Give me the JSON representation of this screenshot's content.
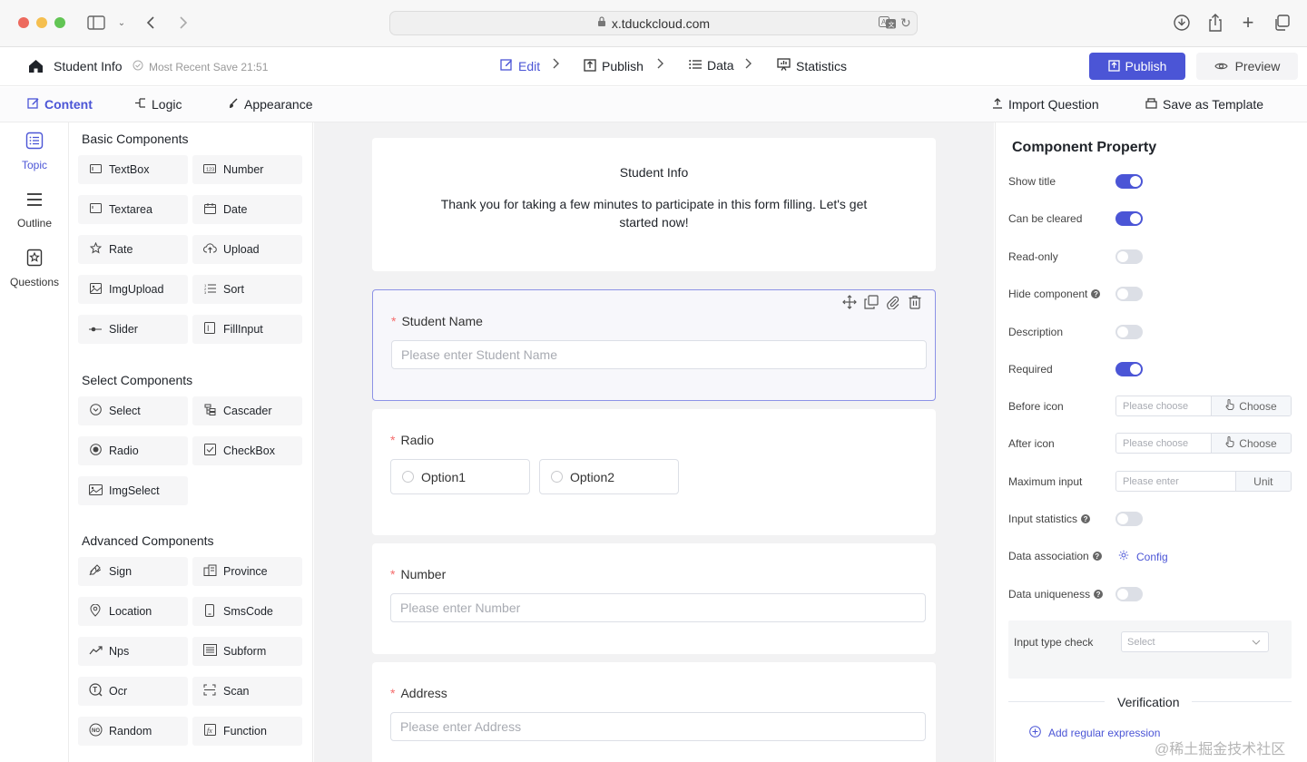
{
  "browser": {
    "url": "x.tduckcloud.com",
    "traffic": [
      "#ed6a5e",
      "#f5bf4f",
      "#62c554"
    ]
  },
  "header": {
    "title": "Student Info",
    "save_status": "Most Recent Save 21:51",
    "steps": [
      "Edit",
      "Publish",
      "Data",
      "Statistics"
    ],
    "active_step": "Edit",
    "publish_label": "Publish",
    "preview_label": "Preview"
  },
  "toolbar": {
    "tabs": [
      "Content",
      "Logic",
      "Appearance"
    ],
    "active_tab": "Content",
    "import_label": "Import Question",
    "template_label": "Save as Template"
  },
  "rail": {
    "items": [
      "Topic",
      "Outline",
      "Questions"
    ],
    "active": "Topic"
  },
  "components": {
    "basic_title": "Basic Components",
    "basic": [
      "TextBox",
      "Number",
      "Textarea",
      "Date",
      "Rate",
      "Upload",
      "ImgUpload",
      "Sort",
      "Slider",
      "FillInput"
    ],
    "select_title": "Select Components",
    "select": [
      "Select",
      "Cascader",
      "Radio",
      "CheckBox",
      "ImgSelect"
    ],
    "advanced_title": "Advanced Components",
    "advanced": [
      "Sign",
      "Province",
      "Location",
      "SmsCode",
      "Nps",
      "Subform",
      "Ocr",
      "Scan",
      "Random",
      "Function"
    ]
  },
  "form": {
    "title": "Student Info",
    "description": "Thank you for taking a few minutes to participate in this form filling. Let's get started now!",
    "q1_label": "Student Name",
    "q1_placeholder": "Please enter Student Name",
    "q2_label": "Radio",
    "q2_options": [
      "Option1",
      "Option2"
    ],
    "q3_label": "Number",
    "q3_placeholder": "Please enter Number",
    "q4_label": "Address",
    "q4_placeholder": "Please enter Address"
  },
  "props": {
    "title": "Component Property",
    "toggles": [
      {
        "label": "Show title",
        "on": true
      },
      {
        "label": "Can be cleared",
        "on": true
      },
      {
        "label": "Read-only",
        "on": false
      },
      {
        "label": "Hide component",
        "on": false
      },
      {
        "label": "Description",
        "on": false
      },
      {
        "label": "Required",
        "on": true
      }
    ],
    "before_icon_label": "Before icon",
    "after_icon_label": "After icon",
    "choose_placeholder": "Please choose",
    "choose_label": "Choose",
    "max_input_label": "Maximum input",
    "max_input_placeholder": "Please enter",
    "unit_label": "Unit",
    "input_stats_label": "Input statistics",
    "input_stats_on": false,
    "data_assoc_label": "Data association",
    "config_label": "Config",
    "data_unique_label": "Data uniqueness",
    "data_unique_on": false,
    "input_type_label": "Input type check",
    "input_type_placeholder": "Select",
    "verification_title": "Verification",
    "add_regex_label": "Add regular expression"
  },
  "watermark": "@稀土掘金技术社区",
  "colors": {
    "accent": "#4b55d6",
    "required": "#f56c6c"
  }
}
